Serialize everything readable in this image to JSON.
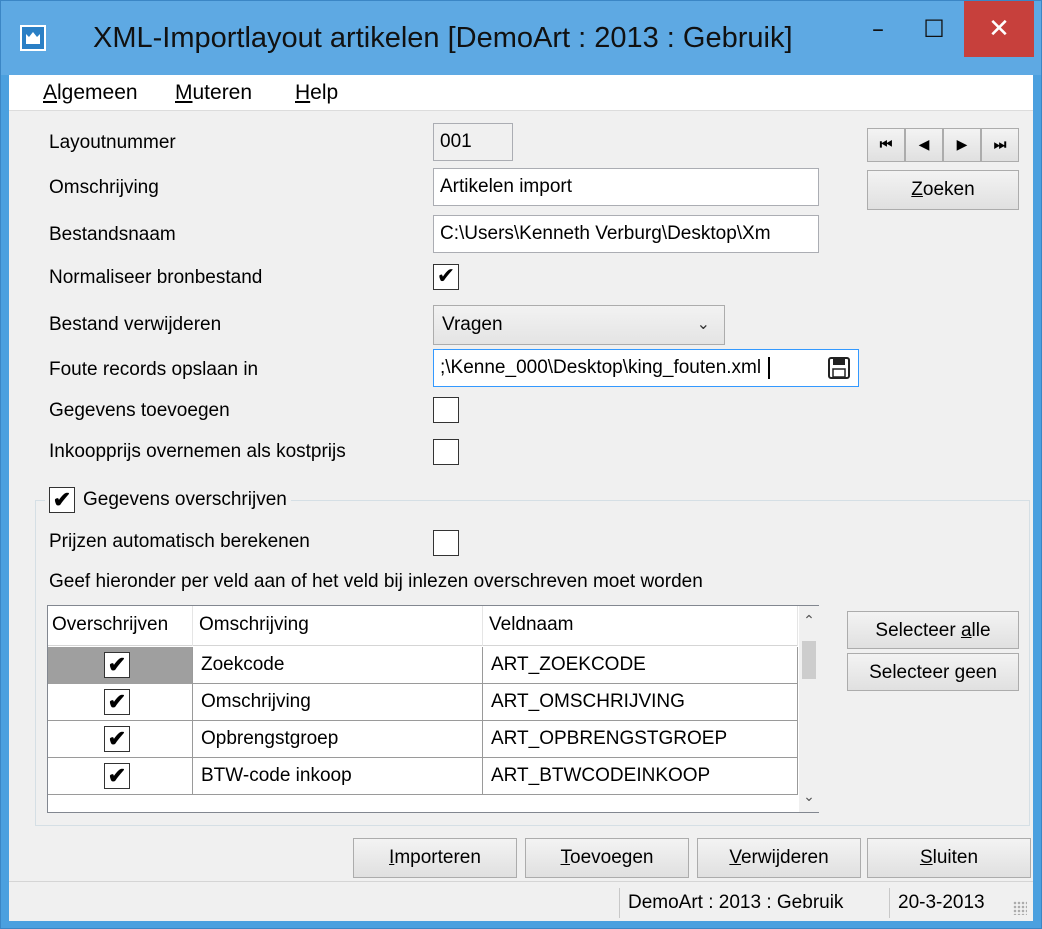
{
  "window": {
    "title": "XML-Importlayout artikelen  [DemoArt : 2013 : Gebruik]",
    "minimize_label": "–",
    "maximize_label": "☐",
    "close_label": "✕"
  },
  "menu": [
    {
      "label_u": "A",
      "label_rest": "lgemeen"
    },
    {
      "label_u": "M",
      "label_rest": "uteren"
    },
    {
      "label_u": "H",
      "label_rest": "elp"
    }
  ],
  "navigation": {
    "first": "⏮",
    "prev": "◀",
    "next": "▶",
    "last": "⏭",
    "search_u": "Z",
    "search_rest": "oeken"
  },
  "form": {
    "layoutnummer_label": "Layoutnummer",
    "layoutnummer_value": "001",
    "omschrijving_label": "Omschrijving",
    "omschrijving_value": "Artikelen import",
    "bestandsnaam_label": "Bestandsnaam",
    "bestandsnaam_value": "C:\\Users\\Kenneth Verburg\\Desktop\\Xm",
    "normaliseer_label": "Normaliseer bronbestand",
    "normaliseer_checked": "✔",
    "verwijderen_label": "Bestand verwijderen",
    "verwijderen_value": "Vragen",
    "foute_label": "Foute records opslaan in",
    "foute_value": ";\\Kenne_000\\Desktop\\king_fouten.xml",
    "toevoegen_label": "Gegevens toevoegen",
    "inkoopprijs_label": "Inkoopprijs overnemen als kostprijs"
  },
  "overschrijven": {
    "legend": "Gegevens overschrijven",
    "legend_checked": "✔",
    "prijzen_label": "Prijzen automatisch berekenen",
    "instruction": "Geef hieronder per veld aan of het veld bij inlezen overschreven moet worden",
    "columns": [
      "Overschrijven",
      "Omschrijving",
      "Veldnaam"
    ],
    "rows": [
      {
        "checked": "✔",
        "omschrijving": "Zoekcode",
        "veldnaam": "ART_ZOEKCODE"
      },
      {
        "checked": "✔",
        "omschrijving": "Omschrijving",
        "veldnaam": "ART_OMSCHRIJVING"
      },
      {
        "checked": "✔",
        "omschrijving": "Opbrengstgroep",
        "veldnaam": "ART_OPBRENGSTGROEP"
      },
      {
        "checked": "✔",
        "omschrijving": "BTW-code inkoop",
        "veldnaam": "ART_BTWCODEINKOOP"
      }
    ],
    "select_all_pre": "Selecteer ",
    "select_all_u": "a",
    "select_all_post": "lle",
    "select_none_pre": "Selecteer ",
    "select_none_u": "g",
    "select_none_post": "een"
  },
  "actions": [
    {
      "u": "I",
      "rest": "mporteren"
    },
    {
      "u": "T",
      "rest": "oevoegen"
    },
    {
      "u": "V",
      "rest": "erwijderen"
    },
    {
      "u": "S",
      "rest": "luiten"
    }
  ],
  "status": {
    "admin": "DemoArt : 2013 : Gebruik",
    "date": "20-3-2013"
  }
}
